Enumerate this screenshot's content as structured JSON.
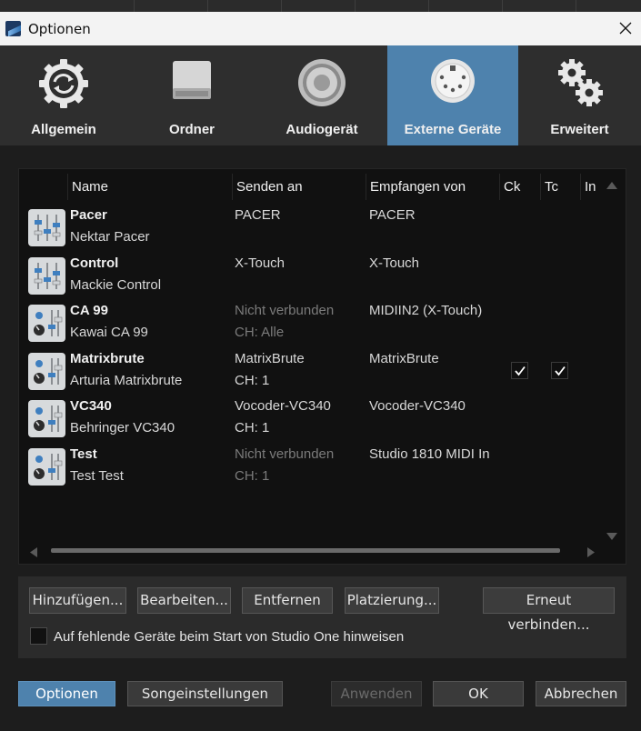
{
  "window": {
    "title": "Optionen"
  },
  "tabs": [
    {
      "label": "Allgemein",
      "icon": "sync-gear-icon"
    },
    {
      "label": "Ordner",
      "icon": "drive-icon"
    },
    {
      "label": "Audiogerät",
      "icon": "speaker-icon"
    },
    {
      "label": "Externe Geräte",
      "icon": "midi-port-icon",
      "active": true
    },
    {
      "label": "Erweitert",
      "icon": "gears-icon"
    }
  ],
  "table": {
    "columns": [
      "Name",
      "Senden an",
      "Empfangen von",
      "Ck",
      "Tc",
      "In"
    ],
    "rows": [
      {
        "name": "Pacer",
        "model": "Nektar Pacer",
        "send": "PACER",
        "send_ch": "",
        "send_dim": false,
        "receive": "PACER",
        "ck": false,
        "tc": false,
        "icon": "fader-controller-icon"
      },
      {
        "name": "Control",
        "model": "Mackie Control",
        "send": "X-Touch",
        "send_ch": "",
        "send_dim": false,
        "receive": "X-Touch",
        "ck": false,
        "tc": false,
        "icon": "fader-controller-icon"
      },
      {
        "name": "CA 99",
        "model": "Kawai CA 99",
        "send": "Nicht verbunden",
        "send_ch": "CH: Alle",
        "send_dim": true,
        "receive": "MIDIIN2 (X-Touch)",
        "ck": false,
        "tc": false,
        "icon": "knob-instrument-icon"
      },
      {
        "name": "Matrixbrute",
        "model": "Arturia Matrixbrute",
        "send": "MatrixBrute",
        "send_ch": "CH: 1",
        "send_dim": false,
        "receive": "MatrixBrute",
        "ck": true,
        "tc": true,
        "icon": "knob-instrument-icon"
      },
      {
        "name": "VC340",
        "model": "Behringer VC340",
        "send": "Vocoder-VC340",
        "send_ch": "CH: 1",
        "send_dim": false,
        "receive": "Vocoder-VC340",
        "ck": false,
        "tc": false,
        "icon": "knob-instrument-icon"
      },
      {
        "name": "Test",
        "model": "Test Test",
        "send": "Nicht verbunden",
        "send_ch": "CH: 1",
        "send_dim": true,
        "receive": "Studio 1810 MIDI In",
        "ck": false,
        "tc": false,
        "icon": "knob-instrument-icon"
      }
    ]
  },
  "actions": {
    "add": "Hinzufügen...",
    "edit": "Bearbeiten...",
    "remove": "Entfernen",
    "placement": "Platzierung...",
    "reconnect": "Erneut verbinden..."
  },
  "notify_checkbox": {
    "label": "Auf fehlende Geräte beim Start von Studio One hinweisen",
    "checked": false
  },
  "footer": {
    "options": "Optionen",
    "song_settings": "Songeinstellungen",
    "apply": "Anwenden",
    "ok": "OK",
    "cancel": "Abbrechen"
  },
  "colors": {
    "accent": "#4e82ad",
    "background": "#1d1d1d",
    "header": "#4a4a4a"
  }
}
